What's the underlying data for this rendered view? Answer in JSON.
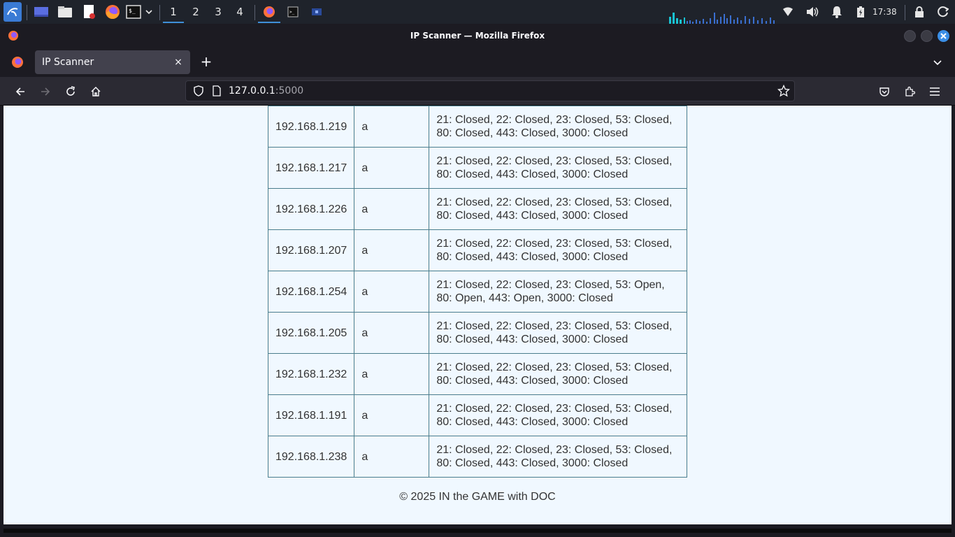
{
  "taskbar": {
    "workspaces": [
      "1",
      "2",
      "3",
      "4"
    ],
    "active_workspace": "1",
    "clock": "17:38"
  },
  "window": {
    "title": "IP Scanner — Mozilla Firefox"
  },
  "tab": {
    "title": "IP Scanner",
    "close": "×",
    "new_tab": "+"
  },
  "urlbar": {
    "host": "127.0.0.1",
    "port": ":5000"
  },
  "table": {
    "rows": [
      {
        "ip": "192.168.1.219",
        "name": "a",
        "ports_line1": "21: Closed, 22: Closed, 23: Closed, 53: Closed,",
        "ports_line2": "80: Closed, 443: Closed, 3000: Closed"
      },
      {
        "ip": "192.168.1.217",
        "name": "a",
        "ports_line1": "21: Closed, 22: Closed, 23: Closed, 53: Closed,",
        "ports_line2": "80: Closed, 443: Closed, 3000: Closed"
      },
      {
        "ip": "192.168.1.226",
        "name": "a",
        "ports_line1": "21: Closed, 22: Closed, 23: Closed, 53: Closed,",
        "ports_line2": "80: Closed, 443: Closed, 3000: Closed"
      },
      {
        "ip": "192.168.1.207",
        "name": "a",
        "ports_line1": "21: Closed, 22: Closed, 23: Closed, 53: Closed,",
        "ports_line2": "80: Closed, 443: Closed, 3000: Closed"
      },
      {
        "ip": "192.168.1.254",
        "name": "a",
        "ports_line1": "21: Closed, 22: Closed, 23: Closed, 53: Open,",
        "ports_line2": "80: Open, 443: Open, 3000: Closed"
      },
      {
        "ip": "192.168.1.205",
        "name": "a",
        "ports_line1": "21: Closed, 22: Closed, 23: Closed, 53: Closed,",
        "ports_line2": "80: Closed, 443: Closed, 3000: Closed"
      },
      {
        "ip": "192.168.1.232",
        "name": "a",
        "ports_line1": "21: Closed, 22: Closed, 23: Closed, 53: Closed,",
        "ports_line2": "80: Closed, 443: Closed, 3000: Closed"
      },
      {
        "ip": "192.168.1.191",
        "name": "a",
        "ports_line1": "21: Closed, 22: Closed, 23: Closed, 53: Closed,",
        "ports_line2": "80: Closed, 443: Closed, 3000: Closed"
      },
      {
        "ip": "192.168.1.238",
        "name": "a",
        "ports_line1": "21: Closed, 22: Closed, 23: Closed, 53: Closed,",
        "ports_line2": "80: Closed, 443: Closed, 3000: Closed"
      }
    ]
  },
  "footer": {
    "text": "© 2025 IN the GAME with DOC"
  },
  "colors": {
    "page_bg": "#f0f8ff",
    "table_border": "#4a7d8c",
    "accent": "#3f8fd8"
  },
  "icons": {
    "taskbar": [
      "kali-menu-icon",
      "desktop-icon",
      "file-manager-icon",
      "text-editor-icon",
      "firefox-icon",
      "terminal-icon",
      "dropdown-icon",
      "firefox-task-icon",
      "terminal-task-icon",
      "window-task-icon",
      "network-icon",
      "volume-icon",
      "notification-icon",
      "battery-icon",
      "lock-icon",
      "power-icon"
    ],
    "navbar": [
      "back-icon",
      "forward-icon",
      "reload-icon",
      "home-icon",
      "shield-icon",
      "page-icon",
      "bookmark-star-icon",
      "pocket-icon",
      "extensions-icon",
      "menu-icon"
    ]
  }
}
